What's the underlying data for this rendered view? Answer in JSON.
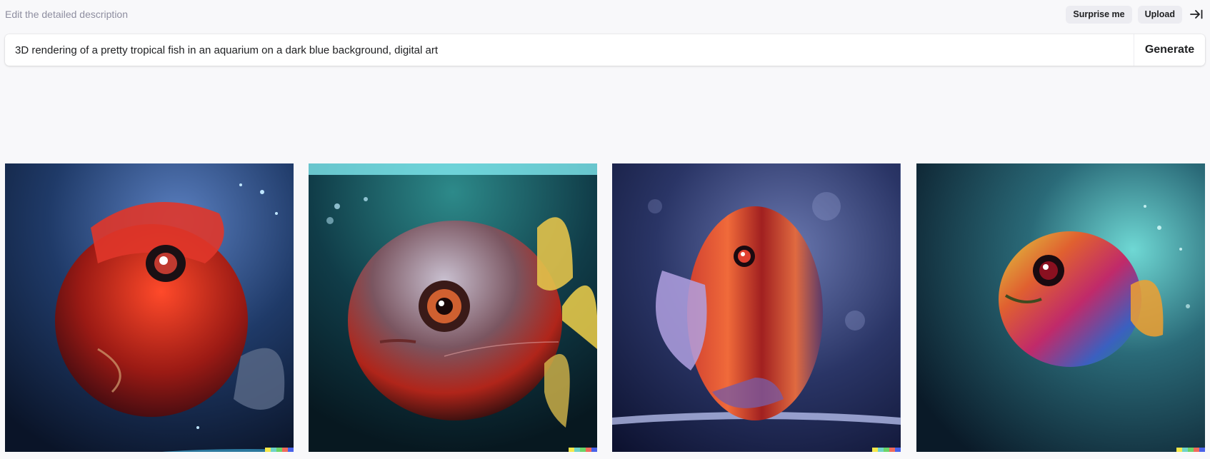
{
  "header": {
    "hint": "Edit the detailed description",
    "surprise_label": "Surprise me",
    "upload_label": "Upload"
  },
  "prompt": {
    "value": "3D rendering of a pretty tropical fish in an aquarium on a dark blue background, digital art",
    "generate_label": "Generate"
  },
  "images": [
    {
      "icon": "fish-image-1"
    },
    {
      "icon": "fish-image-2"
    },
    {
      "icon": "fish-image-3"
    },
    {
      "icon": "fish-image-4"
    }
  ],
  "colors": {
    "signature": [
      "#f5e84a",
      "#6fd3c7",
      "#6bd468",
      "#f06b5b",
      "#4a62e8"
    ]
  }
}
